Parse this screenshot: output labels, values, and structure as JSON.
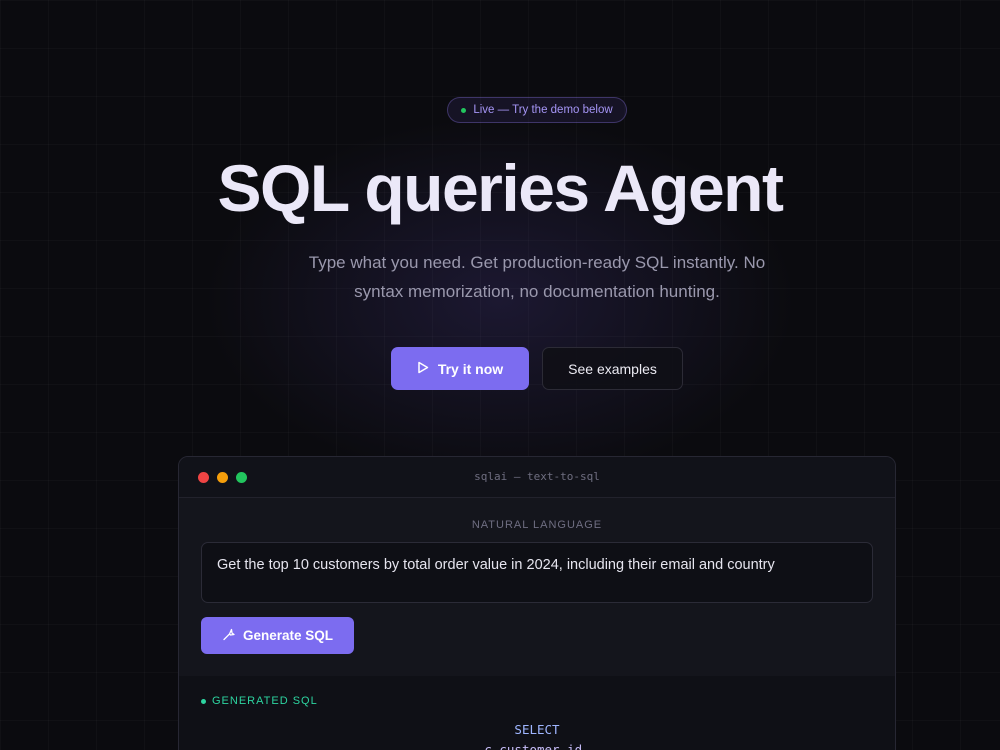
{
  "badge": {
    "text": "Live — Try the demo below",
    "dot_color": "#22c55e"
  },
  "hero": {
    "title": "SQL queries Agent",
    "subtitle": "Type what you need. Get production-ready SQL instantly. No syntax memorization, no documentation hunting."
  },
  "cta": {
    "primary_label": "Try it now",
    "primary_icon": "play-icon",
    "secondary_label": "See examples"
  },
  "demo": {
    "window_title": "sqlai — text-to-sql",
    "traffic_lights": [
      "#ef4444",
      "#f59e0b",
      "#22c55e"
    ],
    "nl_label": "NATURAL LANGUAGE",
    "nl_value": "Get the top 10 customers by total order value in 2024, including their email and country",
    "generate_label": "Generate SQL",
    "generate_icon": "wand-icon",
    "sql_label": "GENERATED SQL",
    "sql_lines": [
      "SELECT",
      "c.customer_id,"
    ]
  },
  "colors": {
    "accent": "#7c6cf0",
    "success": "#2dd4a0"
  }
}
